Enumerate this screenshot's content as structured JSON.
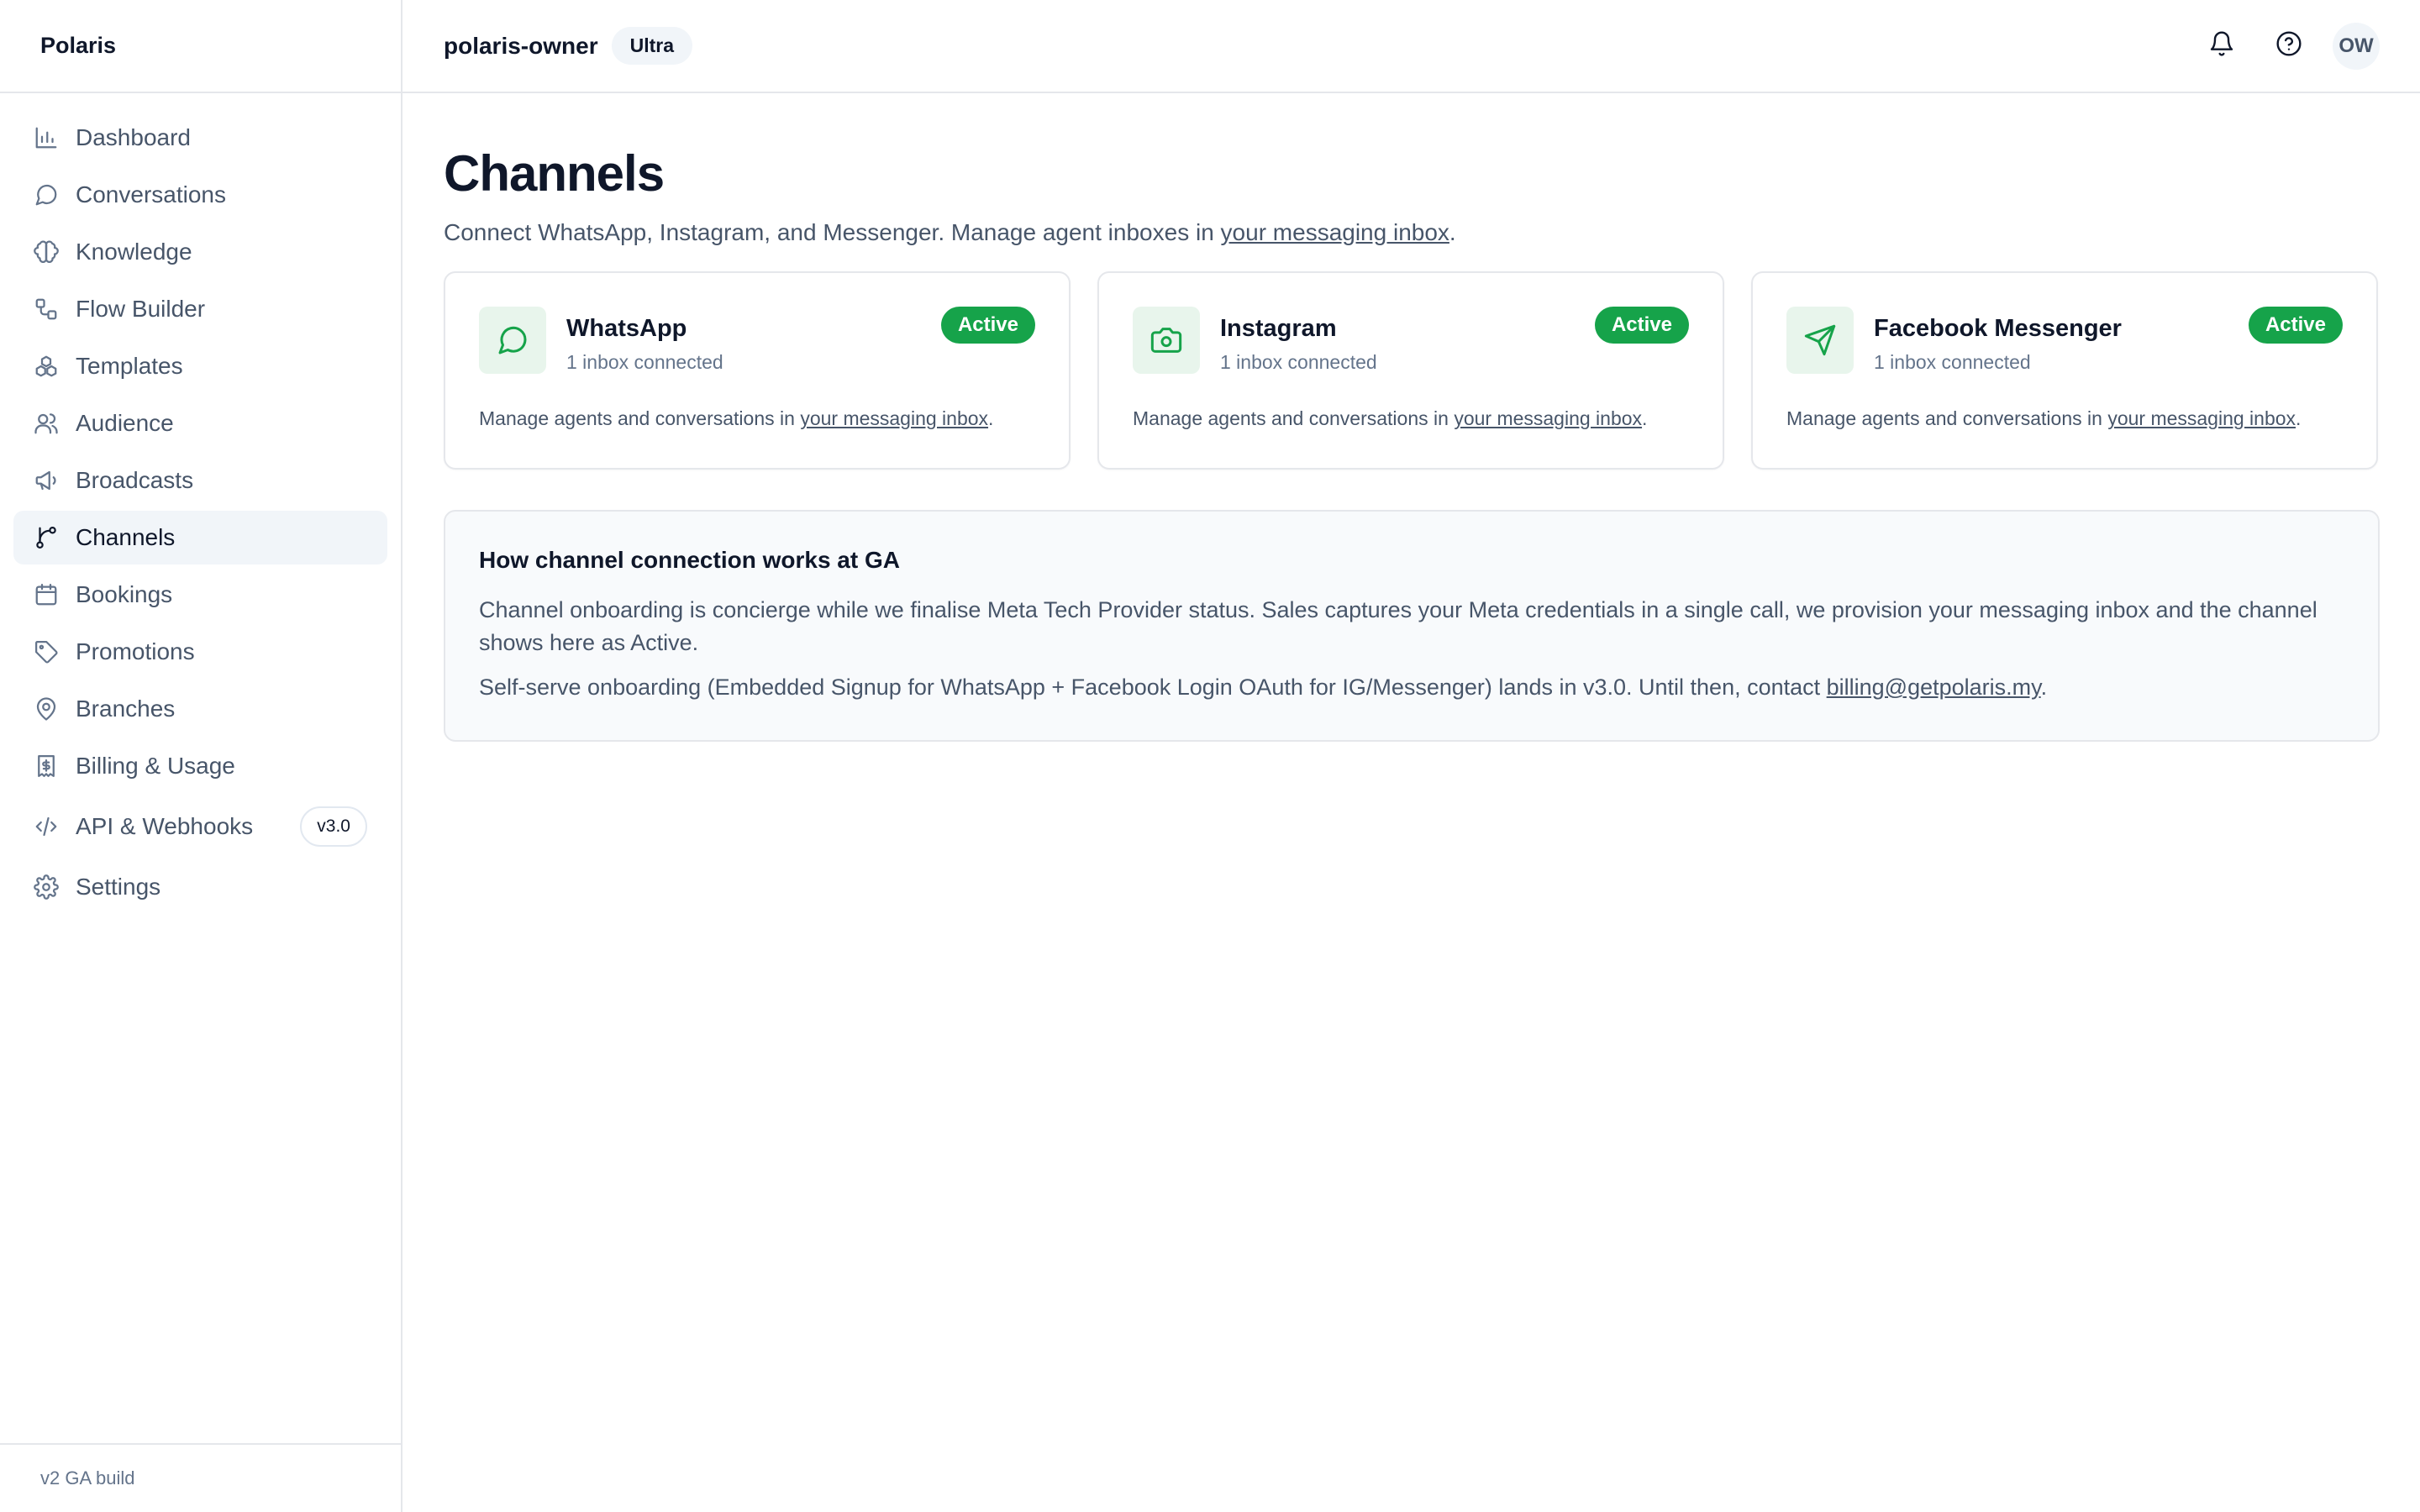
{
  "brand": "Polaris",
  "sidebar": {
    "items": [
      {
        "label": "Dashboard",
        "icon": "bar-chart-icon"
      },
      {
        "label": "Conversations",
        "icon": "message-circle-icon"
      },
      {
        "label": "Knowledge",
        "icon": "brain-icon"
      },
      {
        "label": "Flow Builder",
        "icon": "workflow-icon"
      },
      {
        "label": "Templates",
        "icon": "boxes-icon"
      },
      {
        "label": "Audience",
        "icon": "users-icon"
      },
      {
        "label": "Broadcasts",
        "icon": "megaphone-icon"
      },
      {
        "label": "Channels",
        "icon": "git-branch-icon",
        "active": true
      },
      {
        "label": "Bookings",
        "icon": "calendar-icon"
      },
      {
        "label": "Promotions",
        "icon": "tag-icon"
      },
      {
        "label": "Branches",
        "icon": "map-pin-icon"
      },
      {
        "label": "Billing & Usage",
        "icon": "receipt-icon"
      },
      {
        "label": "API & Webhooks",
        "icon": "code-icon",
        "badge": "v3.0"
      },
      {
        "label": "Settings",
        "icon": "gear-icon"
      }
    ],
    "footer": "v2 GA build"
  },
  "header": {
    "workspace": "polaris-owner",
    "plan": "Ultra",
    "avatar_initials": "OW"
  },
  "page": {
    "title": "Channels",
    "subtitle_prefix": "Connect WhatsApp, Instagram, and Messenger. Manage agent inboxes in ",
    "subtitle_link": "your messaging inbox",
    "subtitle_suffix": "."
  },
  "channels": [
    {
      "name": "WhatsApp",
      "sub": "1 inbox connected",
      "status": "Active",
      "foot_prefix": "Manage agents and conversations in ",
      "foot_link": "your messaging inbox",
      "foot_suffix": "."
    },
    {
      "name": "Instagram",
      "sub": "1 inbox connected",
      "status": "Active",
      "foot_prefix": "Manage agents and conversations in ",
      "foot_link": "your messaging inbox",
      "foot_suffix": "."
    },
    {
      "name": "Facebook Messenger",
      "sub": "1 inbox connected",
      "status": "Active",
      "foot_prefix": "Manage agents and conversations in ",
      "foot_link": "your messaging inbox",
      "foot_suffix": "."
    }
  ],
  "info": {
    "title": "How channel connection works at GA",
    "p1": "Channel onboarding is concierge while we finalise Meta Tech Provider status. Sales captures your Meta credentials in a single call, we provision your messaging inbox and the channel shows here as Active.",
    "p2_prefix": "Self-serve onboarding (Embedded Signup for WhatsApp + Facebook Login OAuth for IG/Messenger) lands in v3.0. Until then, contact ",
    "p2_link": "billing@getpolaris.my",
    "p2_suffix": "."
  },
  "colors": {
    "accent_green": "#16a34a",
    "icon_bg": "#e8f5ec",
    "active_nav_bg": "#f1f5f9"
  }
}
